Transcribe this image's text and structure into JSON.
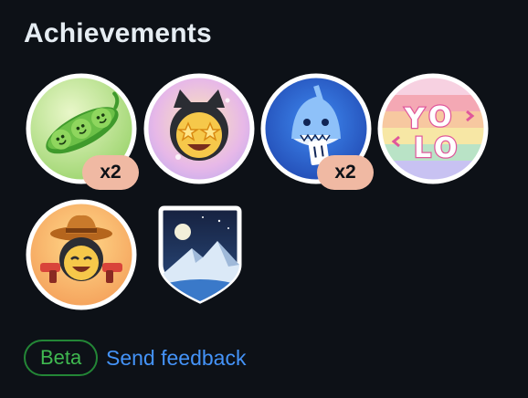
{
  "title": "Achievements",
  "achievements": [
    {
      "name": "pair-extraordinaire",
      "icon": "peas-in-pod-icon",
      "count_label": "x2"
    },
    {
      "name": "starstruck",
      "icon": "starstruck-cat-icon",
      "count_label": ""
    },
    {
      "name": "pull-shark",
      "icon": "shark-icon",
      "count_label": "x2"
    },
    {
      "name": "yolo",
      "icon": "yolo-icon",
      "count_label": ""
    },
    {
      "name": "quickdraw",
      "icon": "cowboy-icon",
      "count_label": ""
    },
    {
      "name": "arctic-code-vault",
      "icon": "mountain-moon-shield-icon",
      "count_label": ""
    }
  ],
  "footer": {
    "beta_label": "Beta",
    "feedback_label": "Send feedback"
  },
  "colors": {
    "background": "#0d1117",
    "title": "#e6edf3",
    "count_badge": "#f0b9a3",
    "beta_border": "#238636",
    "beta_text": "#3fb950",
    "link": "#4493f8"
  }
}
